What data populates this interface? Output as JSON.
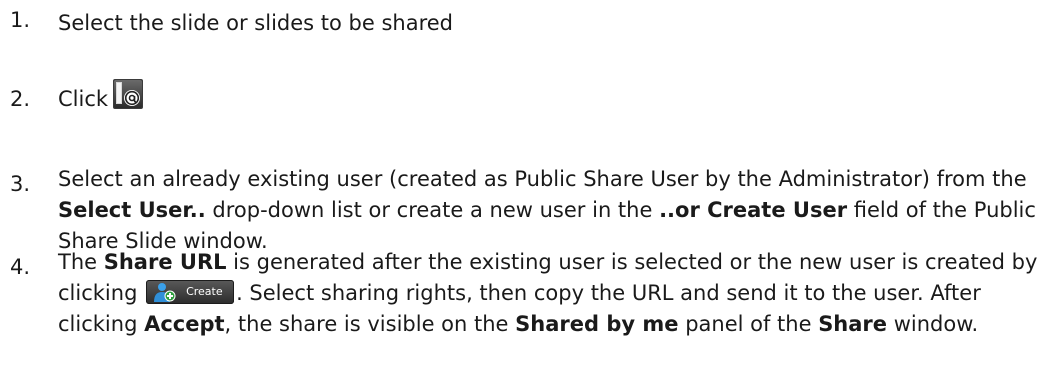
{
  "steps": [
    {
      "number": "1.",
      "text": "Select the slide or slides to be shared"
    },
    {
      "number": "2.",
      "text": "Click",
      "icon": "share-url-icon"
    },
    {
      "number": "3.",
      "p1": "Select an already existing user (created as Public Share User by the Administrator) from the ",
      "b1": "Select User..",
      "p2": " drop-down list or create a new user in the ",
      "b2": "..or Create User",
      "p3": " field of the Public Share Slide window."
    },
    {
      "number": "4.",
      "p1": "The ",
      "b1": "Share URL",
      "p2": " is generated after the existing user is selected or the new user is created by clicking ",
      "button_label": "Create",
      "button_icon": "add-user-icon",
      "p3": ". Select sharing rights, then copy the URL and send it to the user. After clicking ",
      "b2": "Accept",
      "p4": ", the share is visible on the ",
      "b3": "Shared by me",
      "p5": " panel of the ",
      "b4": "Share",
      "p6": " window."
    }
  ],
  "colors": {
    "text": "#1a1a1a",
    "create_button": "#3a3a3a",
    "user_icon_blue": "#2f8fd8",
    "plus_green": "#2e9e3e"
  }
}
